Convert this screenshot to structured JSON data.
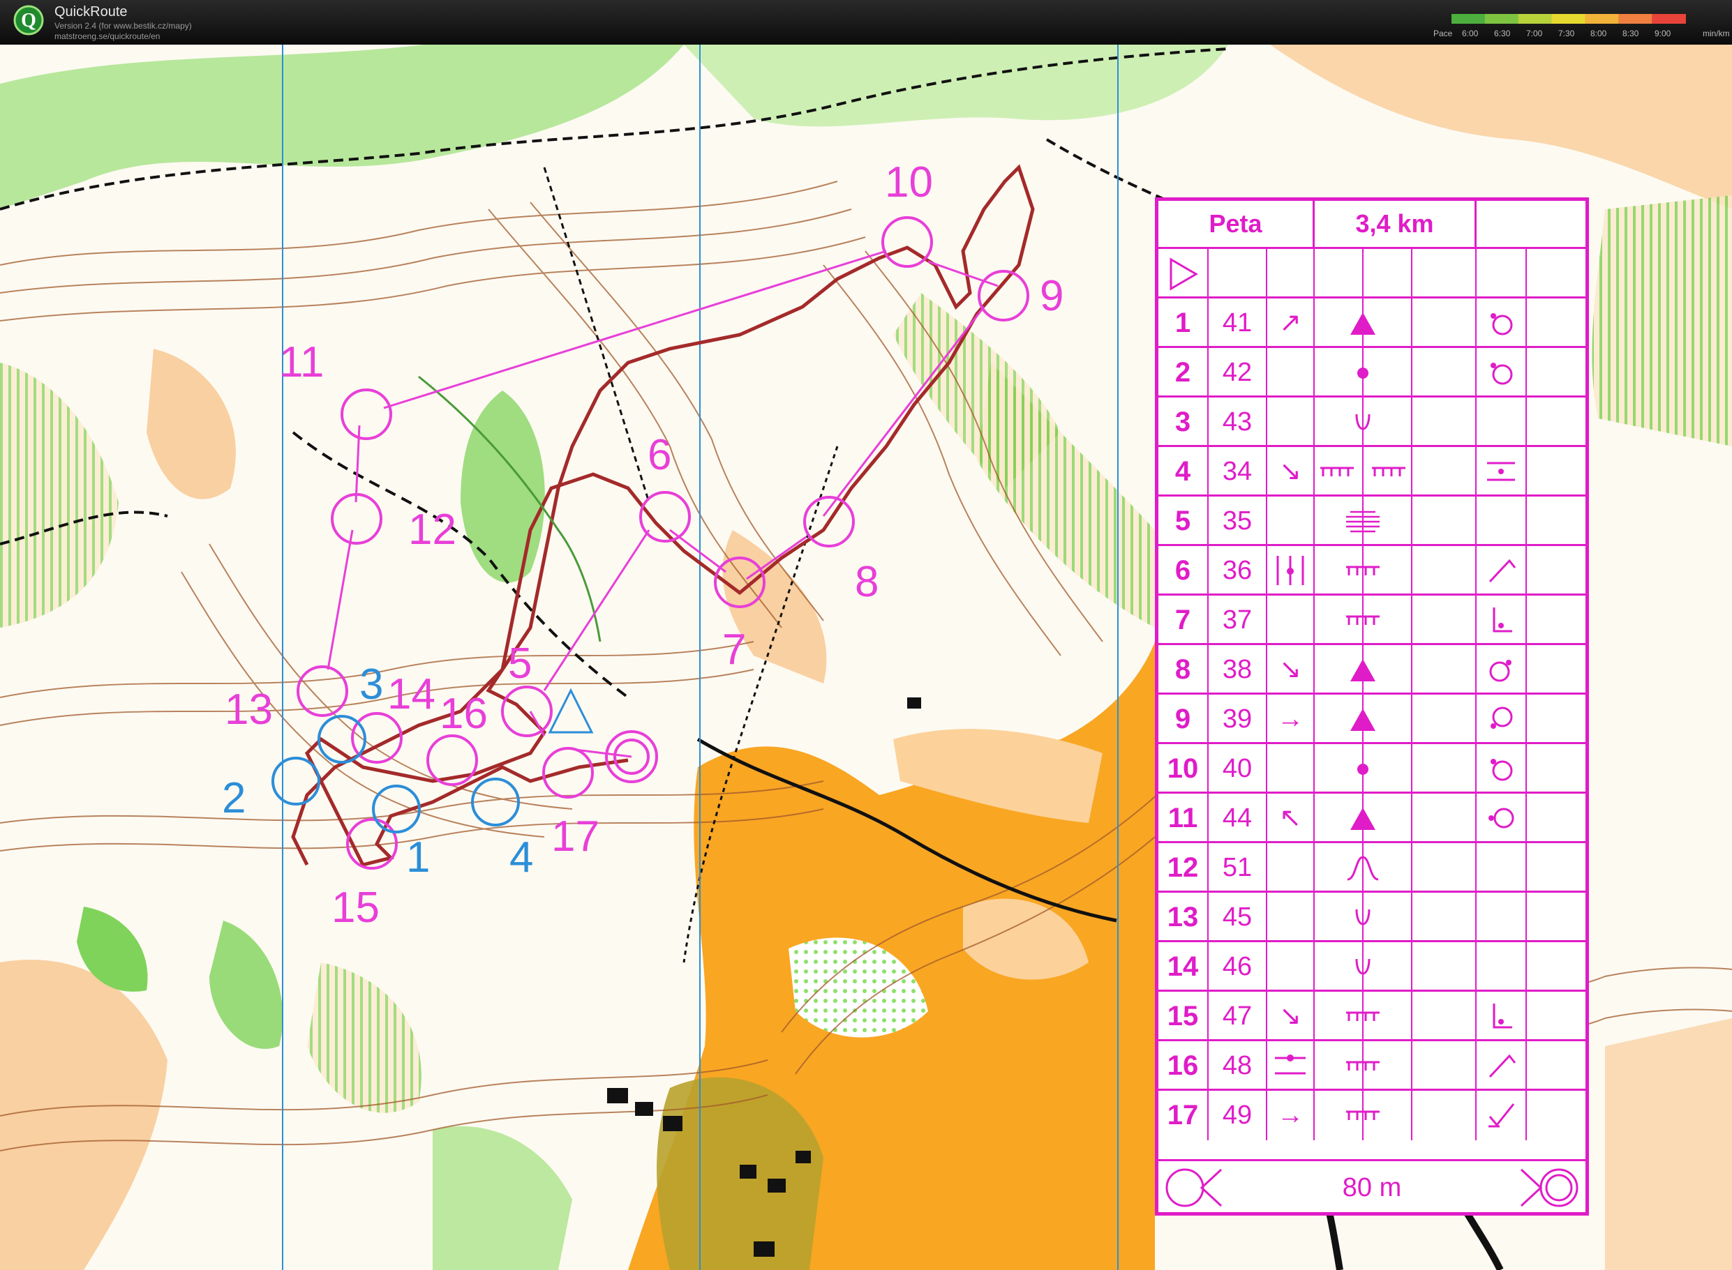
{
  "app": {
    "title": "QuickRoute",
    "version_line": "Version 2.4  (for www.bestik.cz/mapy)",
    "url_line": "matstroeng.se/quickroute/en",
    "logo_letter": "Q"
  },
  "pace_legend": {
    "label": "Pace",
    "ticks": [
      "6:00",
      "6:30",
      "7:00",
      "7:30",
      "8:00",
      "8:30",
      "9:00"
    ],
    "unit": "min/km",
    "colors": [
      "#4caf3e",
      "#7ec441",
      "#b8d23c",
      "#e6d92f",
      "#f2b33a",
      "#ef8040",
      "#e8443a"
    ]
  },
  "course": {
    "color": "#e83fd8",
    "controls": [
      {
        "label": "10"
      },
      {
        "label": "9"
      },
      {
        "label": "11"
      },
      {
        "label": "12"
      },
      {
        "label": "6"
      },
      {
        "label": "8"
      },
      {
        "label": "7"
      },
      {
        "label": "5"
      },
      {
        "label": "13"
      },
      {
        "label": "14"
      },
      {
        "label": "16"
      },
      {
        "label": "17"
      },
      {
        "label": "15"
      }
    ],
    "blue_labels": [
      "3",
      "2",
      "1",
      "4"
    ]
  },
  "control_description": {
    "header": {
      "name": "Peta",
      "length": "3,4 km"
    },
    "rows": [
      {
        "num": "1",
        "code": "41",
        "dir": "↗",
        "feature": "triangle",
        "feature2": "",
        "where": "o-tl"
      },
      {
        "num": "2",
        "code": "42",
        "dir": "",
        "feature": "dot",
        "feature2": "",
        "where": "o-tl"
      },
      {
        "num": "3",
        "code": "43",
        "dir": "",
        "feature": "depression",
        "feature2": "",
        "where": ""
      },
      {
        "num": "4",
        "code": "34",
        "dir": "↘",
        "feature": "cliff",
        "feature2": "cliff",
        "where": "between"
      },
      {
        "num": "5",
        "code": "35",
        "dir": "",
        "feature": "terrace",
        "feature2": "",
        "where": ""
      },
      {
        "num": "6",
        "code": "36",
        "dir": "|+|",
        "feature": "cliff",
        "feature2": "",
        "where": "corner"
      },
      {
        "num": "7",
        "code": "37",
        "dir": "",
        "feature": "cliff",
        "feature2": "",
        "where": "foot"
      },
      {
        "num": "8",
        "code": "38",
        "dir": "↘",
        "feature": "triangle",
        "feature2": "",
        "where": "o-tr"
      },
      {
        "num": "9",
        "code": "39",
        "dir": "→",
        "feature": "triangle",
        "feature2": "",
        "where": "o-bl"
      },
      {
        "num": "10",
        "code": "40",
        "dir": "",
        "feature": "dot",
        "feature2": "",
        "where": "o-tl"
      },
      {
        "num": "11",
        "code": "44",
        "dir": "↖",
        "feature": "triangle",
        "feature2": "",
        "where": "o-l"
      },
      {
        "num": "12",
        "code": "51",
        "dir": "",
        "feature": "spur",
        "feature2": "",
        "where": ""
      },
      {
        "num": "13",
        "code": "45",
        "dir": "",
        "feature": "depression",
        "feature2": "",
        "where": ""
      },
      {
        "num": "14",
        "code": "46",
        "dir": "",
        "feature": "depression",
        "feature2": "",
        "where": ""
      },
      {
        "num": "15",
        "code": "47",
        "dir": "↘",
        "feature": "cliff",
        "feature2": "",
        "where": "foot"
      },
      {
        "num": "16",
        "code": "48",
        "dir": "-•-",
        "feature": "cliff",
        "feature2": "",
        "where": "corner"
      },
      {
        "num": "17",
        "code": "49",
        "dir": "→",
        "feature": "cliff",
        "feature2": "",
        "where": "check"
      }
    ],
    "footer": "80 m"
  }
}
